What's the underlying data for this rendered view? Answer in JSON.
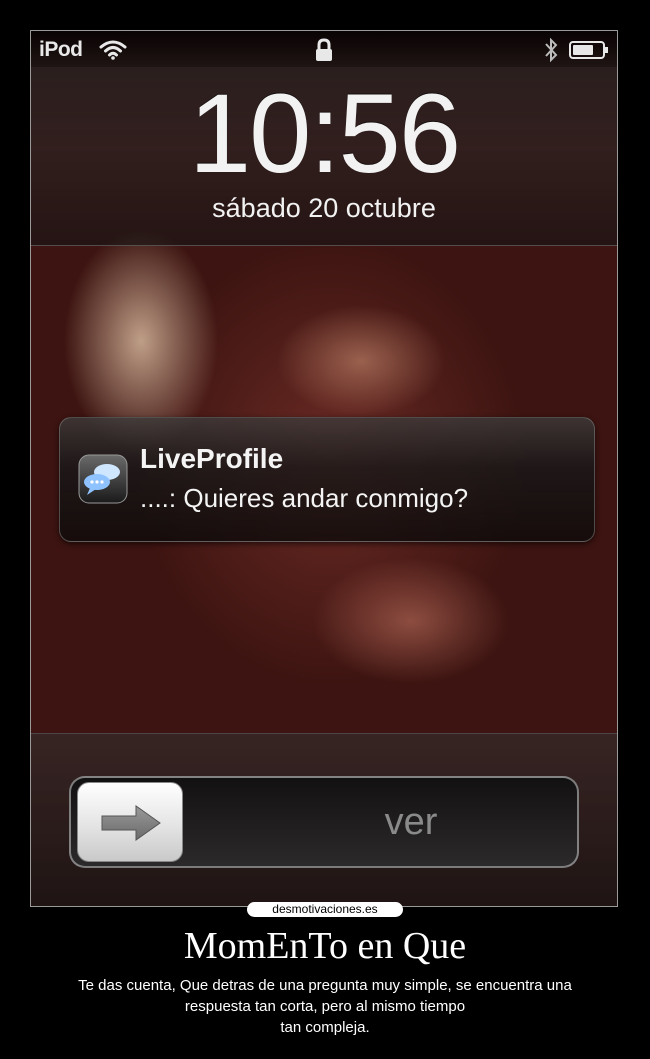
{
  "status_bar": {
    "carrier": "iPod",
    "icons": [
      "wifi-icon",
      "lock-icon",
      "bluetooth-icon",
      "battery-icon"
    ]
  },
  "lock_screen": {
    "time": "10:56",
    "date": "sábado 20 octubre"
  },
  "notification": {
    "app": "LiveProfile",
    "message": "....: Quieres andar conmigo?",
    "icon": "chat-bubbles-icon"
  },
  "unlock_slider": {
    "label": "ver",
    "knob_icon": "arrow-right-icon"
  },
  "poster": {
    "watermark": "desmotivaciones.es",
    "title": "MomEnTo en Que",
    "caption_line1": "Te das cuenta, Que detras de una pregunta muy simple, se encuentra una",
    "caption_line2": "respuesta tan corta, pero al mismo tiempo",
    "caption_line3": "tan compleja."
  },
  "colors": {
    "background": "#000000",
    "text": "#ffffff",
    "slider_label": "#8a8a8a"
  }
}
